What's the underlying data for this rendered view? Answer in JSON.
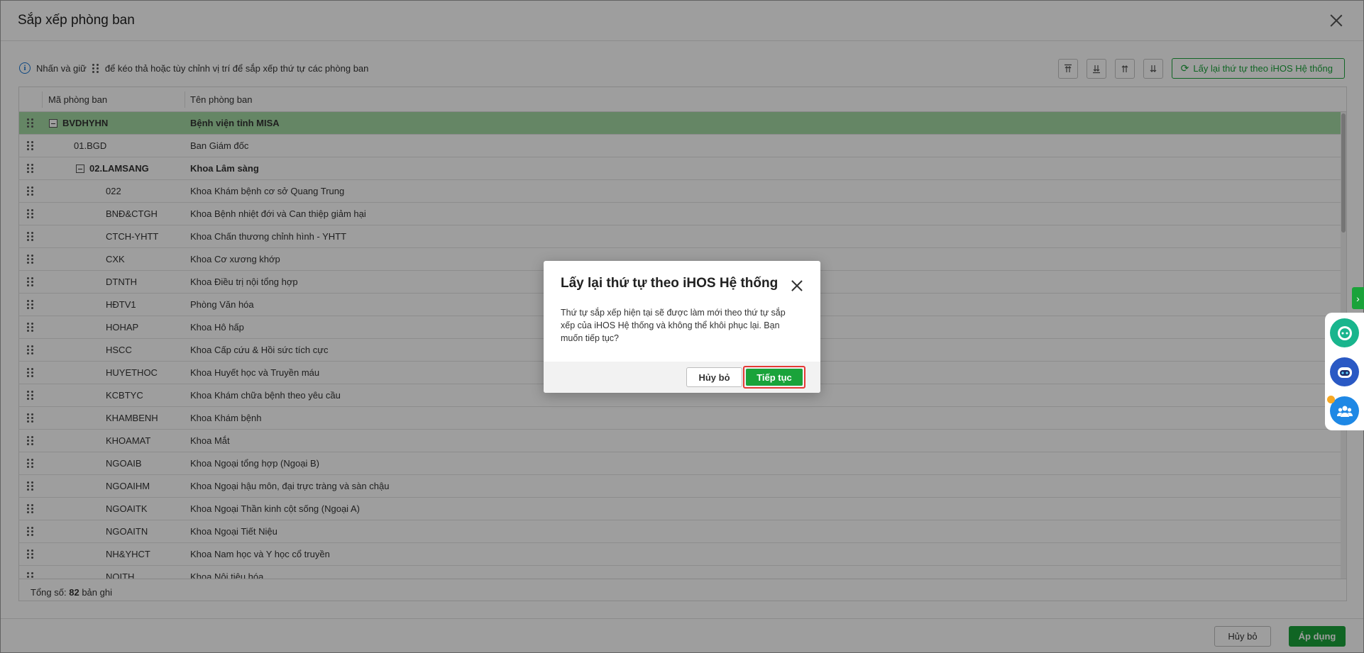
{
  "window": {
    "title": "Sắp xếp phòng ban"
  },
  "hint": {
    "part1": "Nhấn và giữ",
    "part2": "để kéo thả hoặc tùy chỉnh vị trí để sắp xếp thứ tự các phòng ban"
  },
  "toolbar": {
    "tools": [
      "move-to-top-icon",
      "move-to-bottom-icon",
      "move-up-icon",
      "move-down-icon"
    ],
    "reset_label": "Lấy lại thứ tự theo iHOS Hệ thống"
  },
  "grid": {
    "columns": [
      "Mã phòng ban",
      "Tên phòng ban"
    ],
    "rows": [
      {
        "code": "BVDHYHN",
        "name": "Bệnh viện tỉnh MISA",
        "level": 0,
        "group": true,
        "selected": true
      },
      {
        "code": "01.BGD",
        "name": "Ban Giám đốc",
        "level": 1,
        "group": false,
        "selected": false
      },
      {
        "code": "02.LAMSANG",
        "name": "Khoa Lâm sàng",
        "level": 1,
        "group": true,
        "selected": false
      },
      {
        "code": "022",
        "name": "Khoa Khám bệnh cơ sở Quang Trung",
        "level": 2,
        "group": false,
        "selected": false
      },
      {
        "code": "BNĐ&CTGH",
        "name": "Khoa Bệnh nhiệt đới và Can thiệp giảm hại",
        "level": 2,
        "group": false,
        "selected": false
      },
      {
        "code": "CTCH-YHTT",
        "name": "Khoa Chấn thương chỉnh hình - YHTT",
        "level": 2,
        "group": false,
        "selected": false
      },
      {
        "code": "CXK",
        "name": "Khoa Cơ xương khớp",
        "level": 2,
        "group": false,
        "selected": false
      },
      {
        "code": "DTNTH",
        "name": "Khoa Điều trị nội tổng hợp",
        "level": 2,
        "group": false,
        "selected": false
      },
      {
        "code": "HĐTV1",
        "name": "Phòng Văn hóa",
        "level": 2,
        "group": false,
        "selected": false
      },
      {
        "code": "HOHAP",
        "name": "Khoa Hô hấp",
        "level": 2,
        "group": false,
        "selected": false
      },
      {
        "code": "HSCC",
        "name": "Khoa Cấp cứu & Hồi sức tích cực",
        "level": 2,
        "group": false,
        "selected": false
      },
      {
        "code": "HUYETHOC",
        "name": "Khoa Huyết học và Truyền máu",
        "level": 2,
        "group": false,
        "selected": false
      },
      {
        "code": "KCBTYC",
        "name": "Khoa Khám chữa bệnh theo yêu cầu",
        "level": 2,
        "group": false,
        "selected": false
      },
      {
        "code": "KHAMBENH",
        "name": "Khoa Khám bệnh",
        "level": 2,
        "group": false,
        "selected": false
      },
      {
        "code": "KHOAMAT",
        "name": "Khoa Mắt",
        "level": 2,
        "group": false,
        "selected": false
      },
      {
        "code": "NGOAIB",
        "name": "Khoa Ngoại tổng hợp (Ngoại B)",
        "level": 2,
        "group": false,
        "selected": false
      },
      {
        "code": "NGOAIHM",
        "name": "Khoa Ngoại hậu môn, đại trực tràng và sàn chậu",
        "level": 2,
        "group": false,
        "selected": false
      },
      {
        "code": "NGOAITK",
        "name": "Khoa Ngoại Thần kinh cột sống (Ngoại A)",
        "level": 2,
        "group": false,
        "selected": false
      },
      {
        "code": "NGOAITN",
        "name": "Khoa Ngoại Tiết Niệu",
        "level": 2,
        "group": false,
        "selected": false
      },
      {
        "code": "NH&YHCT",
        "name": "Khoa Nam học và Y học cổ truyền",
        "level": 2,
        "group": false,
        "selected": false
      },
      {
        "code": "NOITH",
        "name": "Khoa Nội tiêu hóa",
        "level": 2,
        "group": false,
        "selected": false
      }
    ],
    "footer_label": "Tổng số:",
    "footer_count": "82",
    "footer_unit": "bản ghi"
  },
  "bottom": {
    "cancel_label": "Hủy bỏ",
    "apply_label": "Áp dụng"
  },
  "side_widgets": [
    "chat-icon",
    "robot-icon",
    "community-icon"
  ],
  "modal": {
    "title": "Lấy lại thứ tự theo iHOS Hệ thống",
    "body": "Thứ tự sắp xếp hiện tại sẽ được làm mới theo thứ tự sắp xếp của iHOS Hệ thống và không thể khôi phục lại. Bạn muốn tiếp tục?",
    "cancel_label": "Hủy bỏ",
    "ok_label": "Tiếp tục"
  },
  "colors": {
    "accent": "#1aa33a",
    "selected_row": "#a4d9a4",
    "highlight_border": "#e53935",
    "overlay": "rgba(0,0,0,0.38)"
  }
}
